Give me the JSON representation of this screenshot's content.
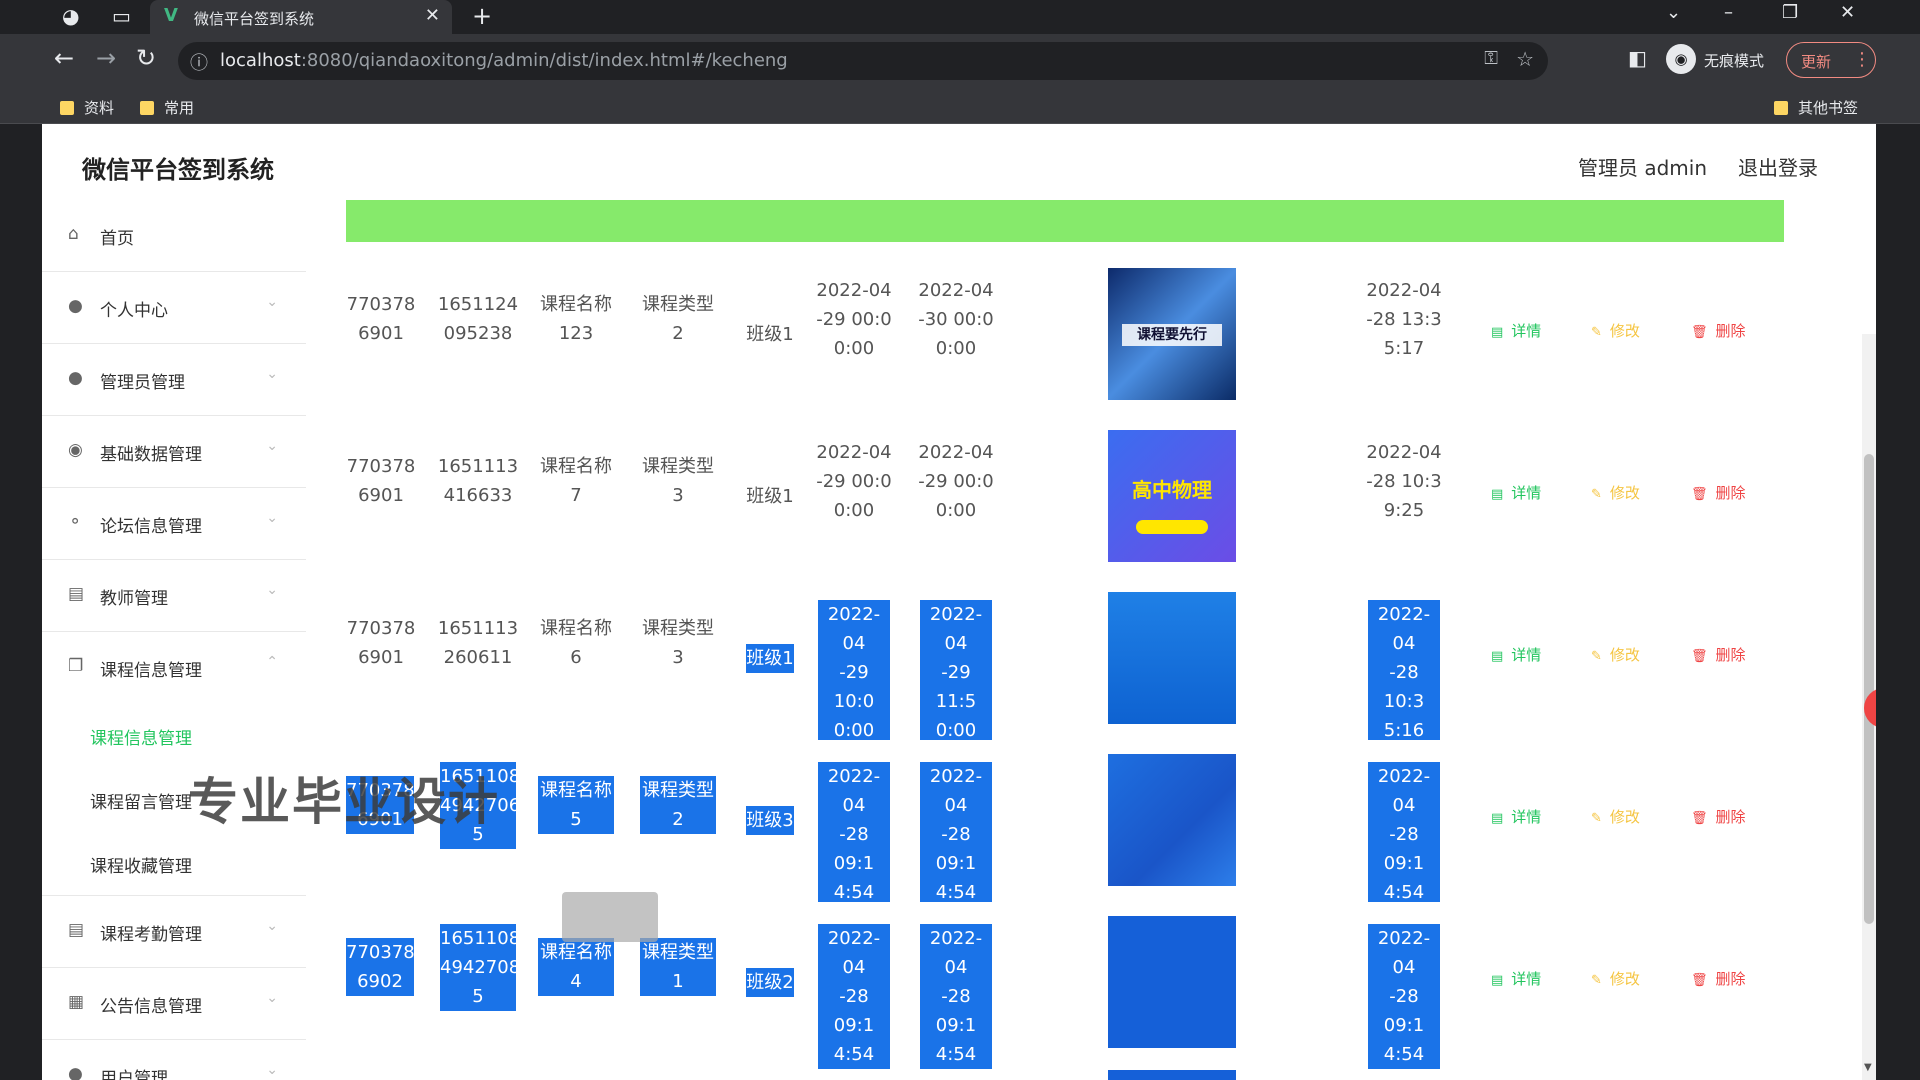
{
  "browser": {
    "tab_title": "微信平台签到系统",
    "url_host": "localhost",
    "url_path": ":8080/qiandaoxitong/admin/dist/index.html#/kecheng",
    "incognito_label": "无痕模式",
    "update_label": "更新",
    "bookmarks": [
      "资料",
      "常用"
    ],
    "other_bookmarks": "其他书签"
  },
  "header": {
    "title": "微信平台签到系统",
    "user": "管理员 admin",
    "logout": "退出登录"
  },
  "sidebar": {
    "items": [
      {
        "label": "首页",
        "icon": "home-icon"
      },
      {
        "label": "个人中心",
        "icon": "user-icon"
      },
      {
        "label": "管理员管理",
        "icon": "user-icon"
      },
      {
        "label": "基础数据管理",
        "icon": "database-icon"
      },
      {
        "label": "论坛信息管理",
        "icon": "microphone-icon"
      },
      {
        "label": "教师管理",
        "icon": "card-icon"
      },
      {
        "label": "课程信息管理",
        "icon": "copy-icon"
      }
    ],
    "submenu": [
      "课程信息管理",
      "课程留言管理",
      "课程收藏管理"
    ],
    "items2": [
      {
        "label": "课程考勤管理",
        "icon": "clipboard-icon"
      },
      {
        "label": "公告信息管理",
        "icon": "grid-icon"
      },
      {
        "label": "用户管理",
        "icon": "user-icon"
      }
    ]
  },
  "table": {
    "actions": {
      "detail": "详情",
      "edit": "修改",
      "delete": "删除"
    },
    "rows": [
      {
        "c1": "770378\n6901",
        "c2": "1651124\n095238",
        "name": "课程名称\n123",
        "type": "课程类型\n2",
        "class": "班级1",
        "start": "2022-04\n-29 00:0\n0:00",
        "end": "2022-04\n-30 00:0\n0:00",
        "created": "2022-04\n-28 13:3\n5:17",
        "thumb_text": "课程要先行"
      },
      {
        "c1": "770378\n6901",
        "c2": "1651113\n416633",
        "name": "课程名称\n7",
        "type": "课程类型\n3",
        "class": "班级1",
        "start": "2022-04\n-29 00:0\n0:00",
        "end": "2022-04\n-29 00:0\n0:00",
        "created": "2022-04\n-28 10:3\n9:25",
        "thumb_text": "高中物理"
      },
      {
        "c1": "770378\n6901",
        "c2": "1651113\n260611",
        "name": "课程名称\n6",
        "type": "课程类型\n3",
        "class": "班级1",
        "start": "2022-04\n-29 10:0\n0:00",
        "end": "2022-04\n-29 11:5\n0:00",
        "created": "2022-04\n-28 10:3\n5:16",
        "thumb_text": ""
      },
      {
        "c1": "770378\n6901",
        "c2": "1651108\n4942706\n5",
        "name": "课程名称\n5",
        "type": "课程类型\n2",
        "class": "班级3",
        "start": "2022-04\n-28 09:1\n4:54",
        "end": "2022-04\n-28 09:1\n4:54",
        "created": "2022-04\n-28 09:1\n4:54",
        "thumb_text": ""
      },
      {
        "c1": "770378\n6902",
        "c2": "1651108\n4942708\n5",
        "name": "课程名称\n4",
        "type": "课程类型\n1",
        "class": "班级2",
        "start": "2022-04\n-28 09:1\n4:54",
        "end": "2022-04\n-28 09:1\n4:54",
        "created": "2022-04\n-28 09:1\n4:54",
        "thumb_text": ""
      }
    ]
  },
  "watermark": "专业毕业设计"
}
